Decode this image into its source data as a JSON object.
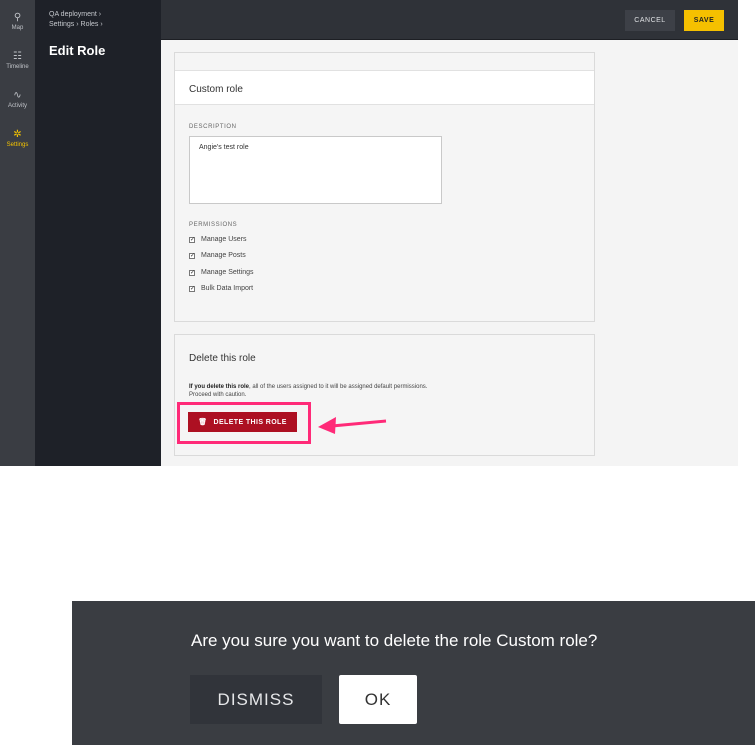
{
  "nav": {
    "items": [
      {
        "label": "Map",
        "icon": "map-pin-icon",
        "glyph": "⚲"
      },
      {
        "label": "Timeline",
        "icon": "timeline-icon",
        "glyph": "☷"
      },
      {
        "label": "Activity",
        "icon": "activity-icon",
        "glyph": "∿"
      },
      {
        "label": "Settings",
        "icon": "gear-icon",
        "glyph": "✲"
      }
    ],
    "active": "Settings",
    "active_color": "#f5c400"
  },
  "breadcrumb": {
    "line1": "QA deployment  ›",
    "line2": "Settings  ›  Roles  ›"
  },
  "page_title": "Edit Role",
  "toolbar": {
    "cancel_label": "CANCEL",
    "save_label": "SAVE",
    "save_color": "#f5c000"
  },
  "role": {
    "name": "Custom role",
    "description_label": "DESCRIPTION",
    "description_value": "Angie's test role",
    "permissions_label": "PERMISSIONS",
    "permissions": [
      {
        "label": "Manage Users",
        "checked": true
      },
      {
        "label": "Manage Posts",
        "checked": true
      },
      {
        "label": "Manage Settings",
        "checked": true
      },
      {
        "label": "Bulk Data Import",
        "checked": true
      }
    ]
  },
  "delete_section": {
    "title": "Delete this role",
    "warning_bold": "If you delete this role",
    "warning_rest": ", all of the users assigned to it will be assigned default permissions. Proceed with caution.",
    "button_label": "DELETE THIS ROLE",
    "button_color": "#ad1022",
    "highlight_color": "#ff2a78"
  },
  "confirm": {
    "message": "Are you sure you want to delete the role Custom role?",
    "dismiss_label": "DISMISS",
    "ok_label": "OK"
  }
}
